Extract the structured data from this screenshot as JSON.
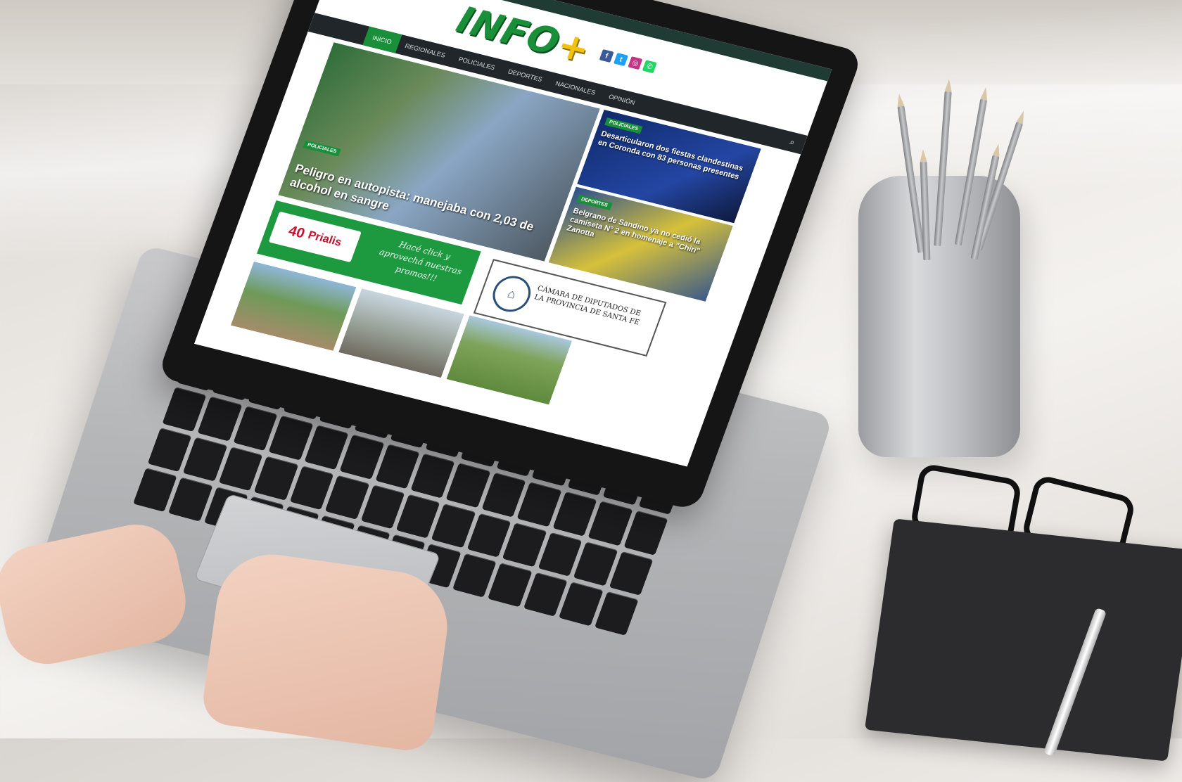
{
  "site": {
    "logo_text": "INFO",
    "logo_plus": "+",
    "nav": [
      "INICIO",
      "REGIONALES",
      "POLICIALES",
      "DEPORTES",
      "NACIONALES",
      "OPINIÓN"
    ],
    "social_icons": [
      "facebook-icon",
      "twitter-icon",
      "instagram-icon",
      "whatsapp-icon"
    ]
  },
  "stories": [
    {
      "badge": "POLICIALES",
      "headline": "Peligro en autopista: manejaba con 2,03 de alcohol en sangre"
    },
    {
      "badge": "POLICIALES",
      "headline": "Desarticularon dos fiestas clandestinas en Coronda con 83 personas presentes"
    },
    {
      "badge": "DEPORTES",
      "headline": "Belgrano de Sandino ya no cedió la camiseta N° 2 en homenaje a \"Chiri\" Zanotta"
    }
  ],
  "ads": {
    "prialis_number": "40",
    "prialis_brand": "Prialis",
    "prialis_promo": "Hacé click y aprovechá nuestras promos!!!",
    "camara_text": "CÁMARA DE DIPUTADOS DE LA PROVINCIA DE SANTA FE"
  },
  "colors": {
    "brand_green": "#1a8f3a",
    "nav_dark": "#20262a",
    "logo_yellow": "#f2c20f"
  }
}
